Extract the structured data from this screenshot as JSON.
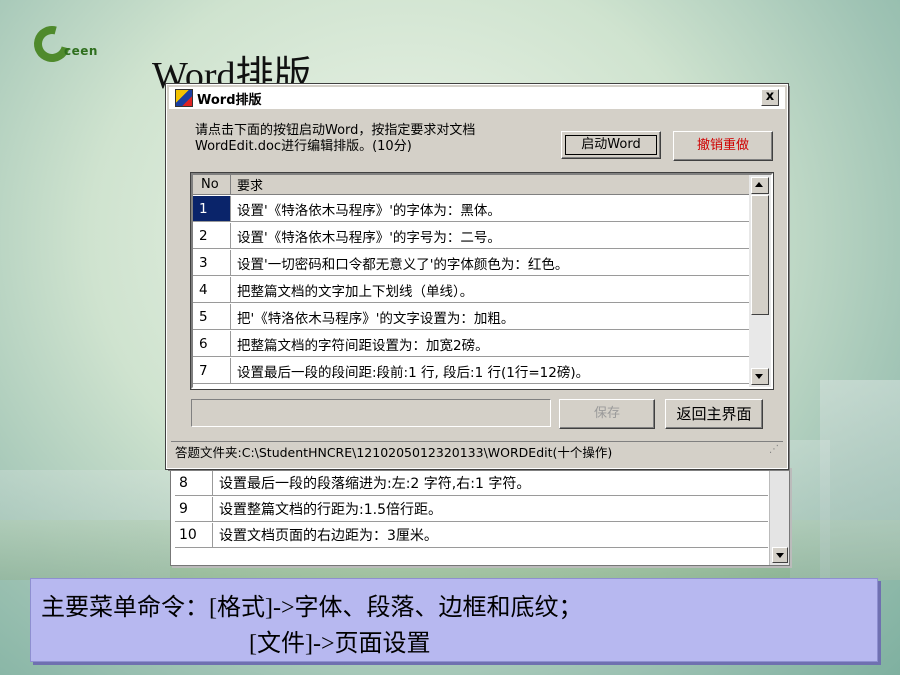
{
  "slide": {
    "logo_text": "ceen",
    "title": "Word排版"
  },
  "dialog": {
    "title": "Word排版",
    "close_label": "x",
    "instruction": "请点击下面的按钮启动Word，按指定要求对文档WordEdit.doc进行编辑排版。(10分)",
    "start_button": "启动Word",
    "undo_button": "撤销重做",
    "list_headers": {
      "no": "No",
      "req": "要求"
    },
    "rows": [
      {
        "no": "1",
        "text": "设置'《特洛依木马程序》'的字体为：黑体。"
      },
      {
        "no": "2",
        "text": "设置'《特洛依木马程序》'的字号为：二号。"
      },
      {
        "no": "3",
        "text": "设置'一切密码和口令都无意义了'的字体颜色为：红色。"
      },
      {
        "no": "4",
        "text": "把整篇文档的文字加上下划线（单线）。"
      },
      {
        "no": "5",
        "text": "把'《特洛依木马程序》'的文字设置为：加粗。"
      },
      {
        "no": "6",
        "text": "把整篇文档的字符间距设置为：加宽2磅。"
      },
      {
        "no": "7",
        "text": "设置最后一段的段间距:段前:1 行, 段后:1 行(1行=12磅)。"
      }
    ],
    "save_button": "保存",
    "back_button": "返回主界面",
    "status": "答题文件夹:C:\\StudentHNCRE\\1210205012320133\\WORDEdit(十个操作)"
  },
  "lower_table": {
    "rows": [
      {
        "no": "8",
        "text": "设置最后一段的段落缩进为:左:2 字符,右:1 字符。"
      },
      {
        "no": "9",
        "text": "设置整篇文档的行距为:1.5倍行距。"
      },
      {
        "no": "10",
        "text": "设置文档页面的右边距为：3厘米。"
      }
    ]
  },
  "note": {
    "line1": "主要菜单命令：[格式]->字体、段落、边框和底纹；",
    "line2": "[文件]->页面设置"
  },
  "colors": {
    "selection": "#0a246a",
    "undo_text": "#d00000",
    "note_bg": "#b7b8f0"
  }
}
